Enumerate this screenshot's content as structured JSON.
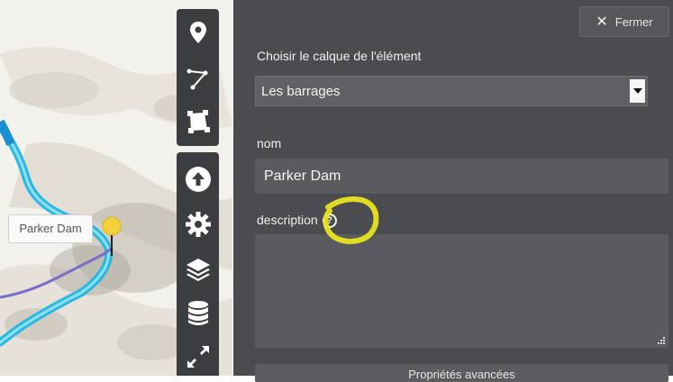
{
  "map": {
    "marker_label": "Parker Dam"
  },
  "toolbar": {
    "tools": [
      {
        "name": "marker-tool",
        "icon": "map-pin-icon"
      },
      {
        "name": "polyline-tool",
        "icon": "polyline-icon"
      },
      {
        "name": "polygon-tool",
        "icon": "polygon-icon"
      },
      {
        "name": "upload-tool",
        "icon": "upload-icon"
      },
      {
        "name": "settings-tool",
        "icon": "gear-icon"
      },
      {
        "name": "layers-tool",
        "icon": "layers-icon"
      },
      {
        "name": "data-tool",
        "icon": "database-icon"
      },
      {
        "name": "fullscreen-tool",
        "icon": "expand-icon"
      }
    ]
  },
  "panel": {
    "close_label": "Fermer",
    "layer_label": "Choisir le calque de l'élément",
    "layer_selected": "Les barrages",
    "name_label": "nom",
    "name_value": "Parker Dam",
    "description_label": "description",
    "description_value": "",
    "bottom_button_label": "Propriétés avancées"
  },
  "colors": {
    "panel_bg": "#4a4c50",
    "toolbar_bg": "#3b3d40",
    "river": "#2ab7e0",
    "route": "#7a6fc8",
    "highlight": "#f2ea1e"
  }
}
